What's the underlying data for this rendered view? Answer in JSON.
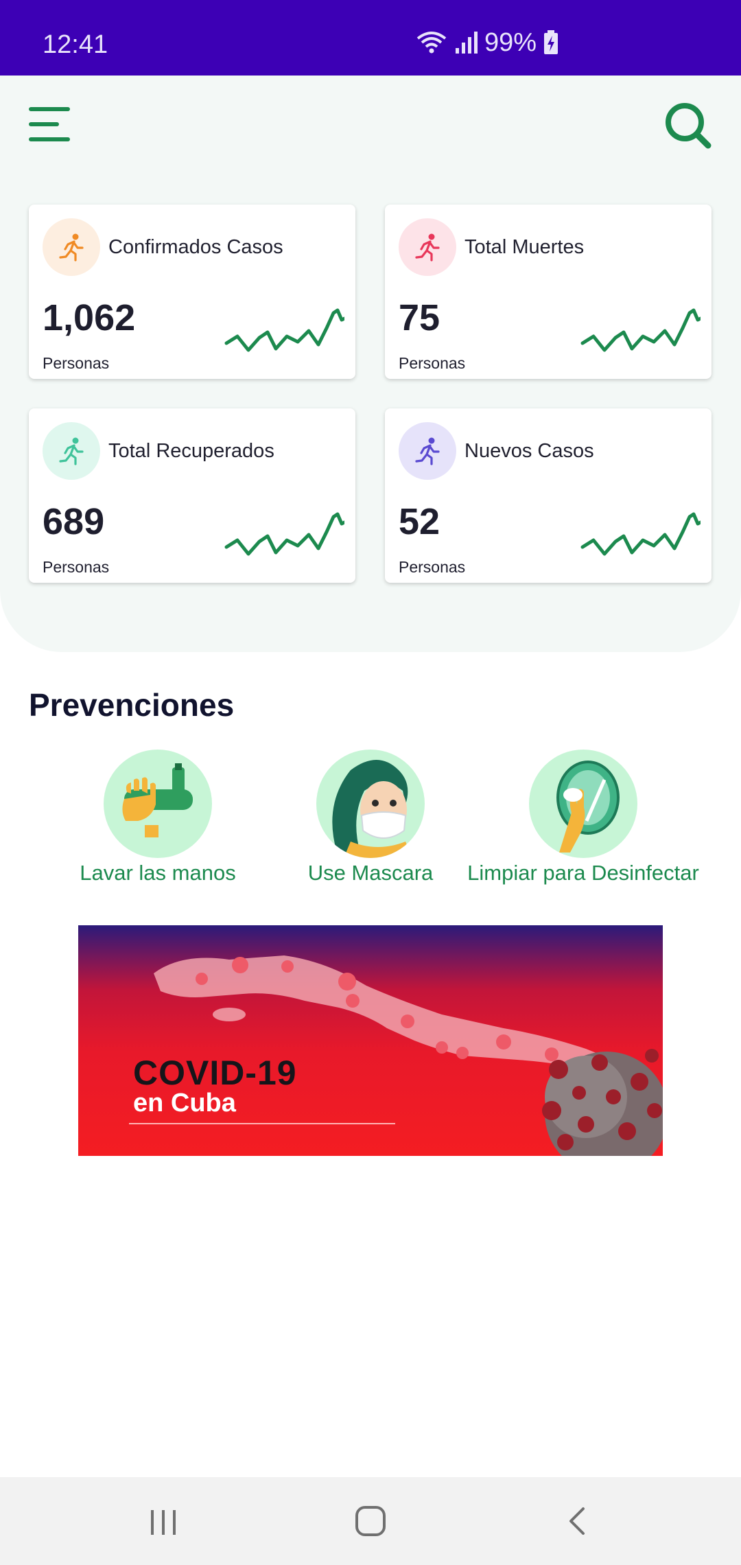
{
  "status_bar": {
    "time": "12:41",
    "battery": "99%"
  },
  "header": {
    "menu_icon": "menu-icon",
    "search_icon": "search-icon"
  },
  "stats": [
    {
      "title": "Confirmados Casos",
      "value": "1,062",
      "unit": "Personas",
      "color": "#f08a24",
      "bg": "#fdeee0"
    },
    {
      "title": "Total Muertes",
      "value": "75",
      "unit": "Personas",
      "color": "#e8375a",
      "bg": "#fde3e8"
    },
    {
      "title": "Total Recuperados",
      "value": "689",
      "unit": "Personas",
      "color": "#3fc39a",
      "bg": "#dff7ee"
    },
    {
      "title": "Nuevos Casos",
      "value": "52",
      "unit": "Personas",
      "color": "#5a4ad1",
      "bg": "#e6e3fa"
    }
  ],
  "prevenciones": {
    "title": "Prevenciones",
    "items": [
      {
        "label": "Lavar las manos",
        "icon": "hand-wash-icon"
      },
      {
        "label": "Use Mascara",
        "icon": "face-mask-icon"
      },
      {
        "label": "Limpiar para Desinfectar",
        "icon": "disinfect-icon"
      }
    ]
  },
  "banner": {
    "title": "COVID-19",
    "subtitle": "en Cuba"
  },
  "colors": {
    "accent": "#1c8a4e",
    "status_bar": "#3d00b5"
  }
}
